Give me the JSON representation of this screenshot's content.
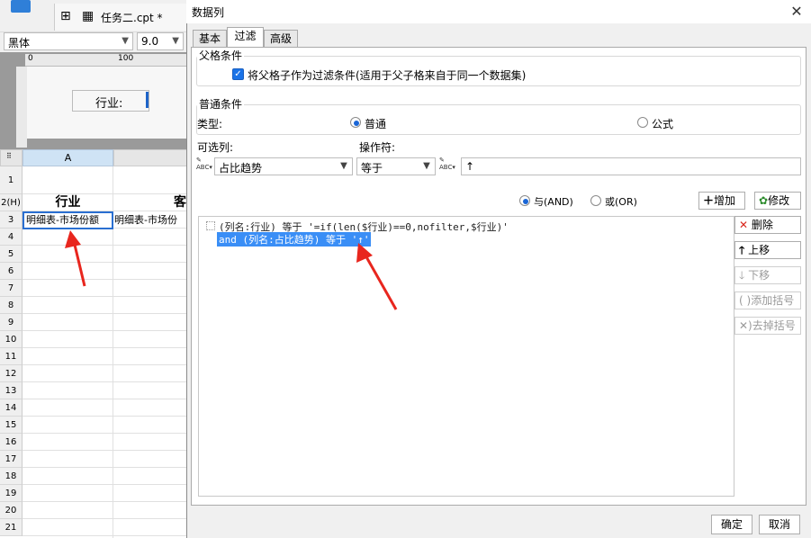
{
  "background_app": {
    "file_tab": "任务二.cpt *",
    "font_name": "黑体",
    "font_size": "9.0",
    "ruler_marks": [
      "0",
      "100"
    ],
    "designer_field_label": "行业:",
    "sheet": {
      "column_headers": [
        "A"
      ],
      "row_numbers": [
        "1",
        "2(H)",
        "3",
        "4",
        "5",
        "6",
        "7",
        "8",
        "9",
        "10",
        "11",
        "12",
        "13",
        "14",
        "15",
        "16",
        "17",
        "18",
        "19",
        "20",
        "21"
      ],
      "header_row": {
        "a": "行业",
        "b": "客"
      },
      "row3": {
        "a": "明细表-市场份额",
        "b": "明细表-市场份"
      }
    }
  },
  "dialog": {
    "title": "数据列",
    "tabs": [
      {
        "label": "基本",
        "active": false
      },
      {
        "label": "过滤",
        "active": true
      },
      {
        "label": "高级",
        "active": false
      }
    ],
    "parent_section": {
      "title": "父格条件",
      "checkbox_label": "将父格子作为过滤条件(适用于父子格来自于同一个数据集)",
      "checked": true
    },
    "normal_section": {
      "title": "普通条件",
      "type_label": "类型:",
      "radio_normal": "普通",
      "radio_formula": "公式",
      "selected_type": "普通",
      "column_label": "可选列:",
      "column_value": "占比趋势",
      "operator_label": "操作符:",
      "operator_value": "等于",
      "value_input": "↑"
    },
    "logic": {
      "and_label": "与(AND)",
      "or_label": "或(OR)",
      "selected": "and"
    },
    "buttons": {
      "add": "增加",
      "modify": "修改",
      "delete": "删除",
      "move_up": "上移",
      "move_down": "下移",
      "add_bracket": "添加括号",
      "remove_bracket": "去掉括号"
    },
    "conditions": [
      "(列名:行业) 等于 '=if(len($行业)==0,nofilter,$行业)'",
      "and (列名:占比趋势) 等于 '↑'"
    ],
    "footer": {
      "ok": "确定",
      "cancel": "取消"
    }
  },
  "colors": {
    "accent": "#1a73e8",
    "selection": "#3a8ef6",
    "annotation_arrow": "#e8261e"
  }
}
